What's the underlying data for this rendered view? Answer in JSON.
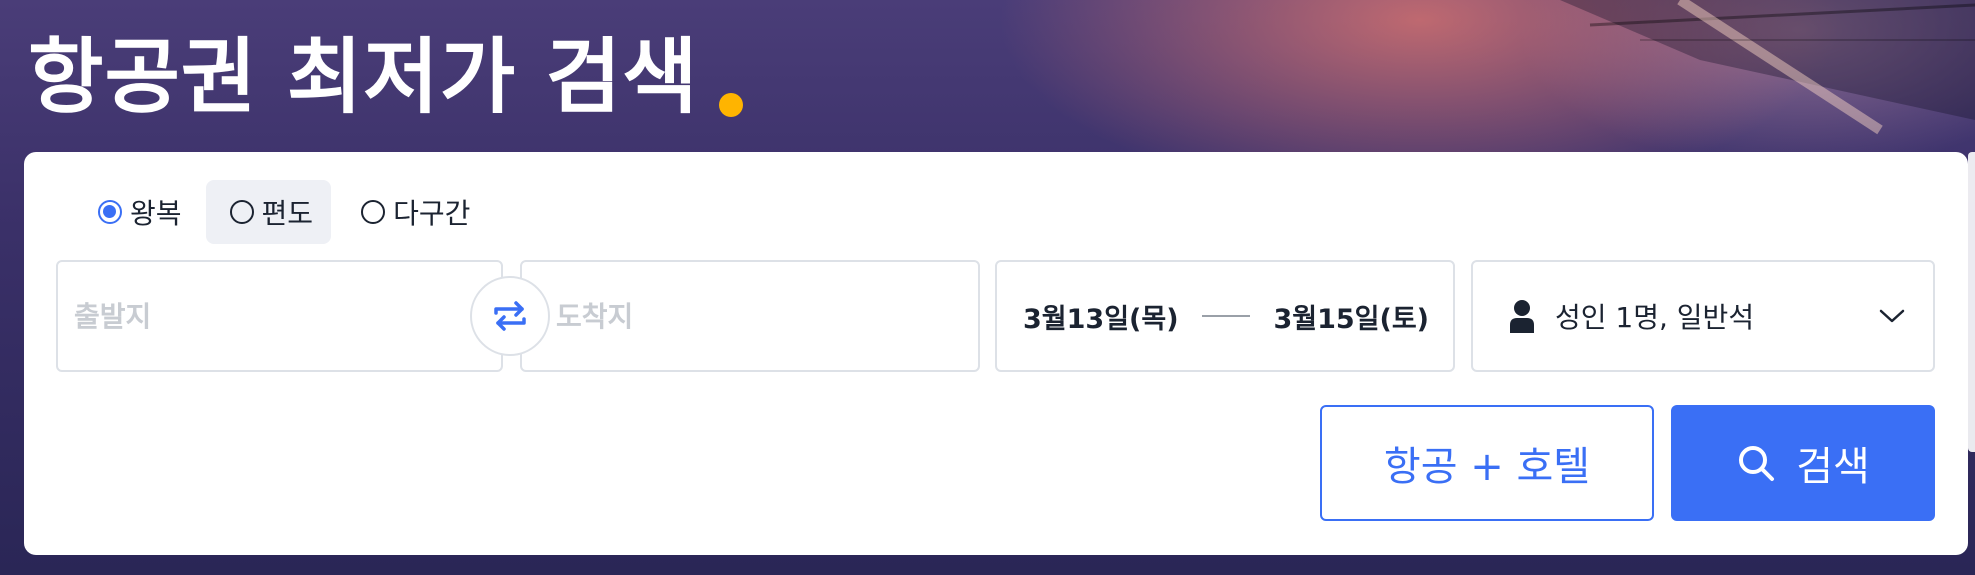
{
  "hero": {
    "title": "항공권 최저가 검색",
    "dot_color": "#ffb400"
  },
  "trip_types": [
    {
      "label": "왕복",
      "selected": true
    },
    {
      "label": "편도",
      "selected": false
    },
    {
      "label": "다구간",
      "selected": false
    }
  ],
  "search": {
    "origin_placeholder": "출발지",
    "destination_placeholder": "도착지",
    "swap_icon": "swap-arrows-icon",
    "depart_date": "3월13일(목)",
    "return_date": "3월15일(토)",
    "passengers": "성인 1명, 일반석",
    "passenger_icon": "person-icon",
    "dropdown_icon": "chevron-down-icon"
  },
  "buttons": {
    "flight_hotel": "항공 + 호텔",
    "search": "검색"
  },
  "colors": {
    "accent": "#3a6ff5",
    "text": "#1b2331",
    "border": "#dde1e7"
  }
}
